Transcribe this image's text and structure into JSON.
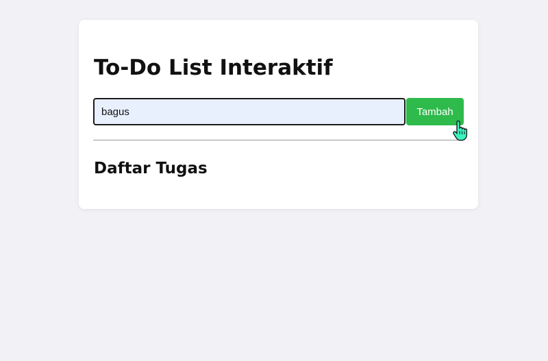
{
  "app": {
    "title": "To-Do List Interaktif",
    "input": {
      "value": "bagus",
      "placeholder": ""
    },
    "add_button_label": "Tambah",
    "list_heading": "Daftar Tugas",
    "tasks": []
  },
  "colors": {
    "page_background": "#f1f1f6",
    "card_background": "#ffffff",
    "input_background": "#e8f0fe",
    "button_background": "#2fba4c",
    "cursor_fill": "#3cf2c0"
  },
  "icons": {
    "cursor": "hand-pointer-icon"
  }
}
